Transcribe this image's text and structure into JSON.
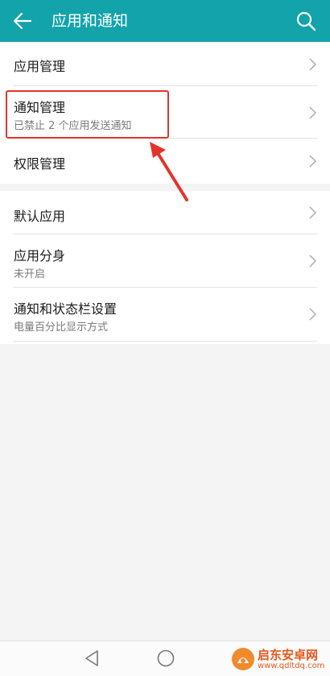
{
  "header": {
    "title": "应用和通知",
    "back_icon": "arrow-left-icon",
    "search_icon": "search-icon",
    "background_color": "#12a3ab"
  },
  "group1": {
    "items": [
      {
        "label": "应用管理",
        "sub": ""
      },
      {
        "label": "通知管理",
        "sub": "已禁止 2 个应用发送通知"
      },
      {
        "label": "权限管理",
        "sub": ""
      }
    ]
  },
  "group2": {
    "items": [
      {
        "label": "默认应用",
        "sub": ""
      },
      {
        "label": "应用分身",
        "sub": "未开启"
      },
      {
        "label": "通知和状态栏设置",
        "sub": "电量百分比显示方式"
      }
    ]
  },
  "annotation": {
    "highlight_color": "#e4332b"
  },
  "navbar": {
    "back_icon": "triangle-back-icon",
    "home_icon": "circle-home-icon"
  },
  "watermark": {
    "name": "启东安卓网",
    "url": "www.qdltdq.com",
    "color": "#e5581c"
  }
}
